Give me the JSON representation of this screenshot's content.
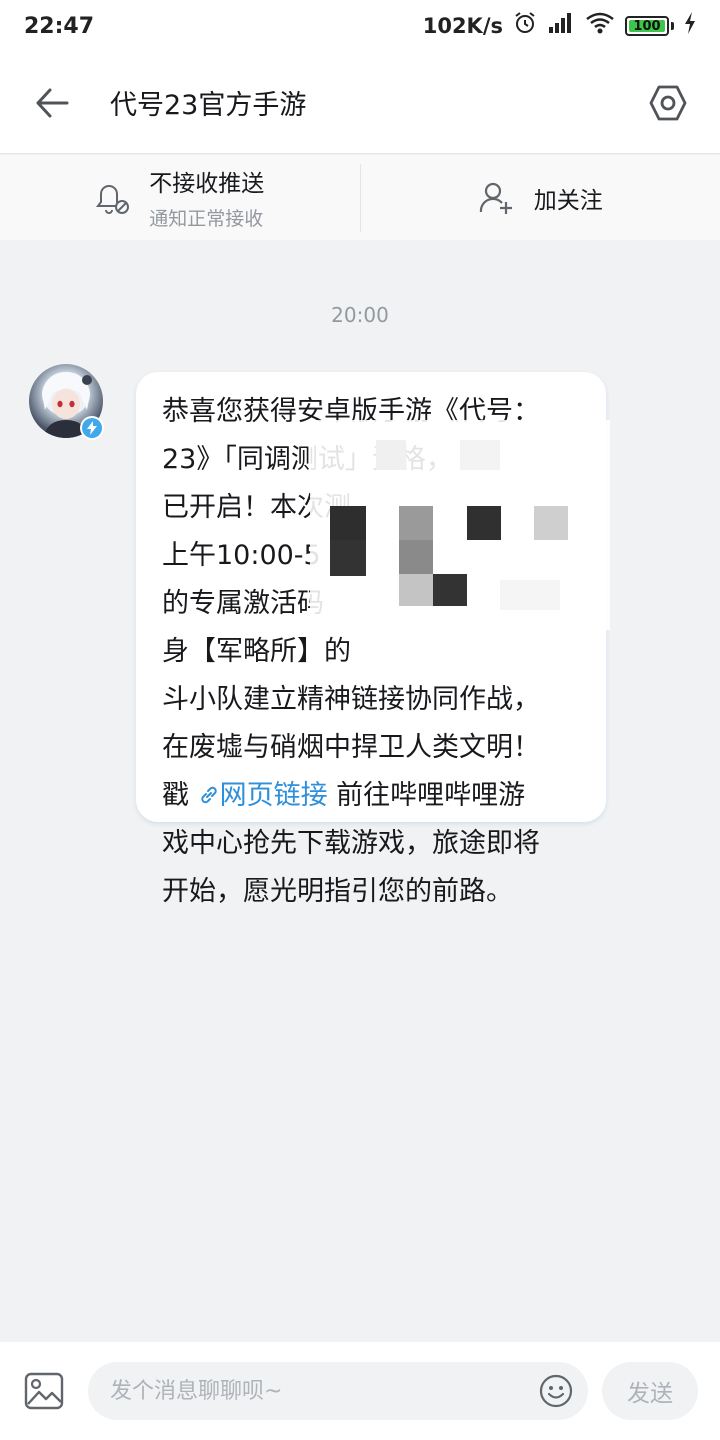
{
  "status_bar": {
    "time": "22:47",
    "net_speed": "102K/s",
    "battery": "100",
    "battery_level_percent": 100,
    "icons": [
      "alarm-icon",
      "signal-icon",
      "wifi-icon",
      "battery-icon",
      "charging-icon"
    ]
  },
  "header": {
    "title": "代号23官方手游",
    "back_icon": "arrow-left-icon",
    "settings_icon": "hexagon-settings-icon"
  },
  "actions": {
    "push": {
      "title": "不接收推送",
      "subtitle": "通知正常接收",
      "icon": "bell-off-icon"
    },
    "follow": {
      "label": "加关注",
      "icon": "add-user-icon"
    }
  },
  "chat": {
    "timestamp": "20:00",
    "message": {
      "lines": [
        "恭喜您获得安卓版手游《代号：",
        "23》「同调测试」资格，",
        "已开启！本次测",
        "上午10:00-5",
        "的专属激活码",
        "身【军略所】的",
        "斗小队建立精神链接协同作战，",
        "在废墟与硝烟中捍卫人类文明！"
      ],
      "link_prefix": "戳",
      "link_text": "网页链接",
      "link_suffix": " 前往哔哩哔哩游",
      "lines_after": [
        "戏中心抢先下载游戏，旅途即将",
        "开始，愿光明指引您的前路。"
      ]
    }
  },
  "input_bar": {
    "placeholder": "发个消息聊聊呗~",
    "send_label": "发送",
    "image_icon": "image-icon",
    "emoji_icon": "emoji-icon"
  },
  "colors": {
    "background": "#f1f2f3",
    "link": "#2e8fdb",
    "verify_badge": "#3fa9ec",
    "battery_fill": "#3ec64a"
  }
}
